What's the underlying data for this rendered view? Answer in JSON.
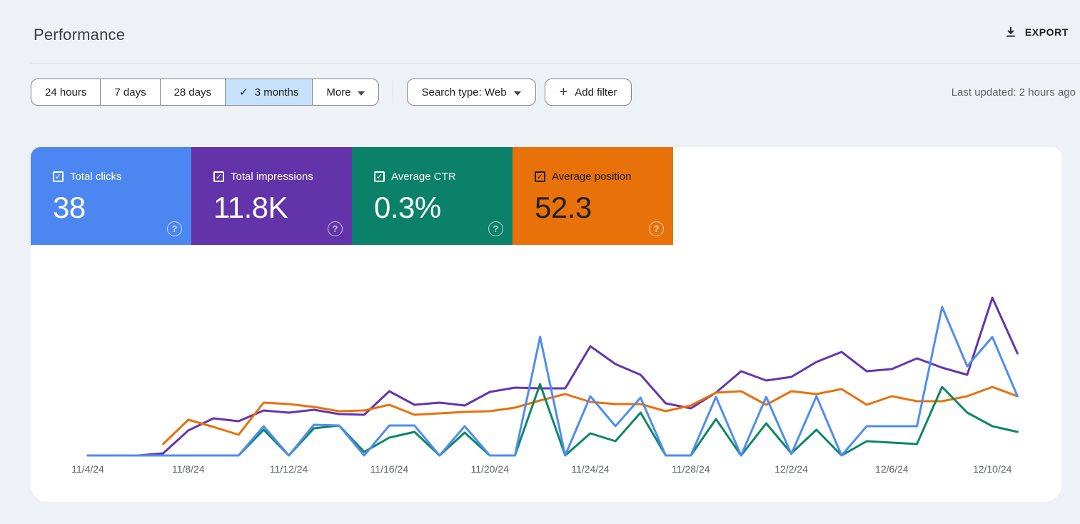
{
  "header": {
    "title": "Performance",
    "export_label": "EXPORT"
  },
  "toolbar": {
    "date_ranges": [
      {
        "label": "24 hours",
        "selected": false
      },
      {
        "label": "7 days",
        "selected": false
      },
      {
        "label": "28 days",
        "selected": false
      },
      {
        "label": "3 months",
        "selected": true
      },
      {
        "label": "More",
        "selected": false,
        "menu": true
      }
    ],
    "search_type": {
      "label": "Search type: Web"
    },
    "add_filter": {
      "label": "Add filter"
    },
    "last_updated": "Last updated: 2 hours ago"
  },
  "metrics": [
    {
      "label": "Total clicks",
      "value": "38",
      "checked": true,
      "color": "#4c86f0",
      "text_color": "#ffffff"
    },
    {
      "label": "Total impressions",
      "value": "11.8K",
      "checked": true,
      "color": "#6233a9",
      "text_color": "#ffffff"
    },
    {
      "label": "Average CTR",
      "value": "0.3%",
      "checked": true,
      "color": "#0b8169",
      "text_color": "#ffffff"
    },
    {
      "label": "Average position",
      "value": "52.3",
      "checked": true,
      "color": "#e8710a",
      "text_color": "#202124"
    }
  ],
  "icons": {
    "export": "download-icon",
    "date_range_selected": "checkmark-icon",
    "more": "chevron-down-icon",
    "search_type": "chevron-down-icon",
    "add_filter": "plus-icon",
    "metric_checkbox": "checkbox-checked-icon",
    "metric_help": "help-icon"
  },
  "colors": {
    "page_background": "#eef1f6",
    "card_background": "#ffffff",
    "selected_chip": "#c6e1fa",
    "button_border": "#82868b",
    "text_primary": "#1f1f1f",
    "text_secondary": "#5f6368"
  },
  "chart_data": {
    "type": "line",
    "title": "Search performance over time",
    "xlabel": "",
    "ylabel": "",
    "y_axis_note": "no y-axis shown; values are relative line heights above baseline (0 = baseline), traced from the chart",
    "x": [
      "11/4/24",
      "11/5/24",
      "11/6/24",
      "11/7/24",
      "11/8/24",
      "11/9/24",
      "11/10/24",
      "11/11/24",
      "11/12/24",
      "11/13/24",
      "11/14/24",
      "11/15/24",
      "11/16/24",
      "11/17/24",
      "11/18/24",
      "11/19/24",
      "11/20/24",
      "11/21/24",
      "11/22/24",
      "11/23/24",
      "11/24/24",
      "11/25/24",
      "11/26/24",
      "11/27/24",
      "11/28/24",
      "11/29/24",
      "11/30/24",
      "12/1/24",
      "12/2/24",
      "12/3/24",
      "12/4/24",
      "12/5/24",
      "12/6/24",
      "12/7/24",
      "12/8/24",
      "12/9/24",
      "12/10/24",
      "12/11/24"
    ],
    "x_tick_labels": [
      "11/4/24",
      "11/8/24",
      "11/12/24",
      "11/16/24",
      "11/20/24",
      "11/24/24",
      "11/28/24",
      "12/2/24",
      "12/6/24",
      "12/10/24"
    ],
    "tick_every_days": 4,
    "grid": false,
    "legend": "metric cards act as legend",
    "series": [
      {
        "name": "Total impressions",
        "color": "#6334b1",
        "values": [
          0,
          0,
          0,
          3,
          35,
          52,
          48,
          63,
          60,
          64,
          58,
          57,
          90,
          71,
          74,
          70,
          89,
          95,
          94,
          94,
          153,
          128,
          113,
          73,
          66,
          88,
          118,
          105,
          110,
          131,
          145,
          118,
          121,
          136,
          123,
          113,
          221,
          143
        ]
      },
      {
        "name": "Average position",
        "color": "#e8710a",
        "values": [
          null,
          null,
          null,
          16,
          50,
          40,
          29,
          74,
          72,
          68,
          62,
          63,
          71,
          57,
          59,
          61,
          62,
          67,
          77,
          86,
          75,
          72,
          72,
          62,
          70,
          88,
          90,
          71,
          90,
          86,
          93,
          71,
          83,
          76,
          76,
          83,
          96,
          83
        ]
      },
      {
        "name": "Average CTR",
        "color": "#0d8766",
        "values": [
          0,
          0,
          0,
          0,
          0,
          0,
          0,
          36,
          0,
          38,
          42,
          5,
          25,
          33,
          0,
          32,
          0,
          0,
          100,
          0,
          31,
          20,
          60,
          0,
          0,
          51,
          0,
          45,
          3,
          36,
          0,
          20,
          18,
          16,
          96,
          60,
          41,
          33
        ]
      },
      {
        "name": "Total clicks",
        "color": "#4e8df2",
        "values": [
          0,
          0,
          0,
          0,
          0,
          0,
          0,
          41,
          0,
          43,
          42,
          0,
          42,
          42,
          0,
          41,
          0,
          0,
          166,
          0,
          83,
          41,
          81,
          0,
          0,
          82,
          0,
          82,
          2,
          83,
          0,
          41,
          41,
          41,
          208,
          125,
          166,
          83
        ]
      }
    ]
  }
}
